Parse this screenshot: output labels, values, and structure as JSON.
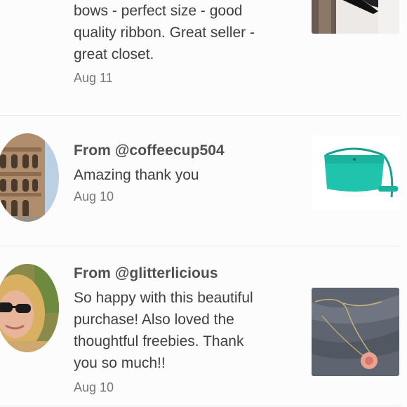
{
  "reviews": [
    {
      "message_lines": [
        "bows - perfect size - good",
        "quality ribbon. Great seller -",
        "great closet."
      ],
      "date": "Aug 11"
    },
    {
      "from": "From @coffeecup504",
      "message_lines": [
        "Amazing thank you"
      ],
      "date": "Aug 10"
    },
    {
      "from": "From @glitterlicious",
      "message_lines": [
        "So happy with this beautiful",
        "purchase! Also loved the",
        "thoughtful freebies. Thank",
        "you so much!!"
      ],
      "date": "Aug 10"
    }
  ],
  "colors": {
    "background": "#fcfcfc",
    "divider": "#ececec",
    "text": "#3d3d3d",
    "date": "#777777"
  }
}
